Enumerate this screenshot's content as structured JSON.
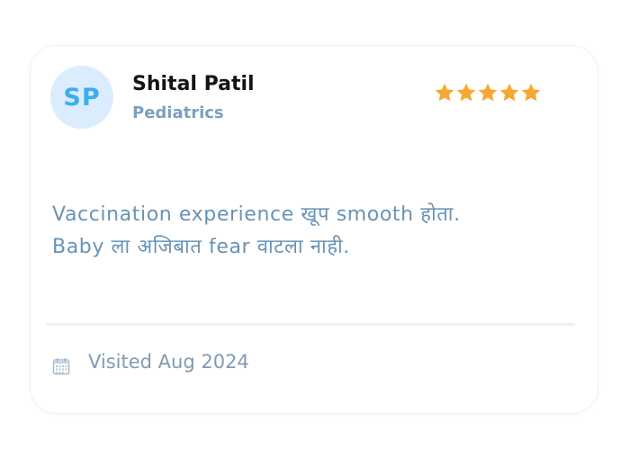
{
  "reviewer": {
    "initials": "SP",
    "name": "Shital Patil",
    "specialty": "Pediatrics"
  },
  "rating": {
    "value": 5,
    "max": 5,
    "icon": "star-icon",
    "color": "#f7a733"
  },
  "review": {
    "line1": "Vaccination experience खूप smooth होता.",
    "line2": "Baby ला अजिबात fear वाटला नाही."
  },
  "visit": {
    "icon": "calendar-icon",
    "text": "Visited Aug 2024"
  },
  "colors": {
    "accent": "#3aaef0",
    "avatar_bg": "#dcecff",
    "review_text": "#6893b6",
    "muted_text": "#7f9bb5"
  }
}
